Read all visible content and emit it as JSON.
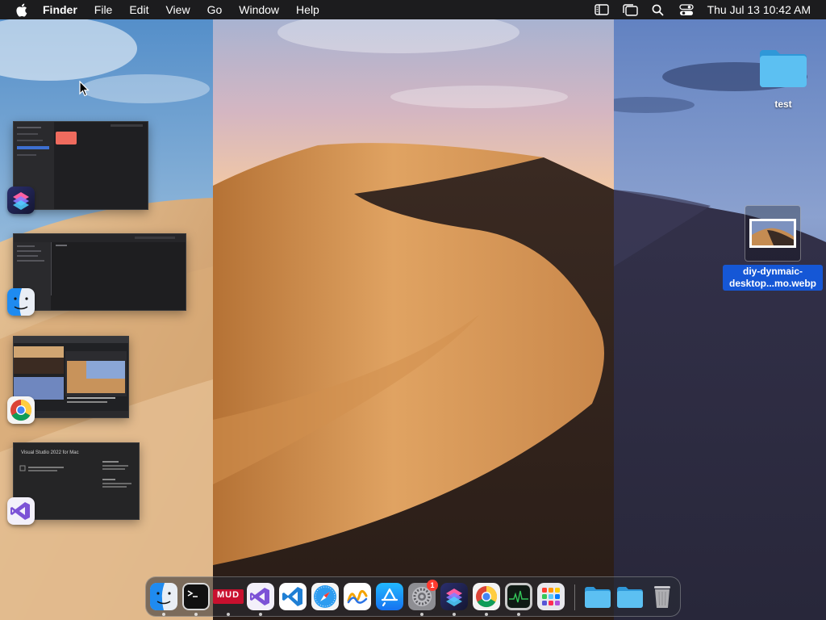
{
  "menubar": {
    "app_name": "Finder",
    "menus": [
      "File",
      "Edit",
      "View",
      "Go",
      "Window",
      "Help"
    ],
    "clock": "Thu Jul 13  10:42 AM",
    "status_icons": [
      "sidebar-icon",
      "stage-manager-icon",
      "search-icon",
      "control-center-icon"
    ]
  },
  "desktop": {
    "folder_label": "test",
    "file_label_line1": "diy-dynmaic-",
    "file_label_line2": "desktop...mo.webp"
  },
  "stage_manager": {
    "groups": [
      {
        "app": "Shortcuts",
        "icon": "shortcuts-icon",
        "thumb_note": ""
      },
      {
        "app": "Finder",
        "icon": "finder-icon",
        "thumb_note": ""
      },
      {
        "app": "Google Chrome",
        "icon": "chrome-icon",
        "thumb_note": ""
      },
      {
        "app": "Visual Studio",
        "icon": "visual-studio-icon",
        "thumb_note": "Visual Studio 2022 for Mac"
      }
    ]
  },
  "dock": {
    "apps": [
      {
        "name": "Finder",
        "icon": "finder-icon",
        "running": true
      },
      {
        "name": "Terminal",
        "icon": "terminal-icon",
        "running": true
      },
      {
        "name": "MUD",
        "icon": "mud-icon",
        "running": true
      },
      {
        "name": "Visual Studio",
        "icon": "visual-studio-icon",
        "running": true
      },
      {
        "name": "Visual Studio Code",
        "icon": "vscode-icon",
        "running": false
      },
      {
        "name": "Safari",
        "icon": "safari-icon",
        "running": false
      },
      {
        "name": "Freeform",
        "icon": "freeform-icon",
        "running": false
      },
      {
        "name": "App Store",
        "icon": "app-store-icon",
        "running": false
      },
      {
        "name": "System Settings",
        "icon": "system-settings-icon",
        "running": true,
        "badge": "1"
      },
      {
        "name": "Shortcuts",
        "icon": "shortcuts-icon",
        "running": true
      },
      {
        "name": "Google Chrome",
        "icon": "chrome-icon",
        "running": true
      },
      {
        "name": "Activity Monitor",
        "icon": "activity-monitor-icon",
        "running": true
      },
      {
        "name": "Launchpad",
        "icon": "launchpad-icon",
        "running": false
      }
    ],
    "stacks": [
      {
        "name": "Applications",
        "icon": "folder-icon"
      },
      {
        "name": "Downloads",
        "icon": "folder-icon"
      },
      {
        "name": "Trash",
        "icon": "trash-icon"
      }
    ],
    "mud_label": "MUD"
  },
  "colors": {
    "menubar": "#1c1c1e",
    "selection": "#1557d6",
    "folder": "#4ab3ea",
    "badge": "#ff3b30"
  }
}
